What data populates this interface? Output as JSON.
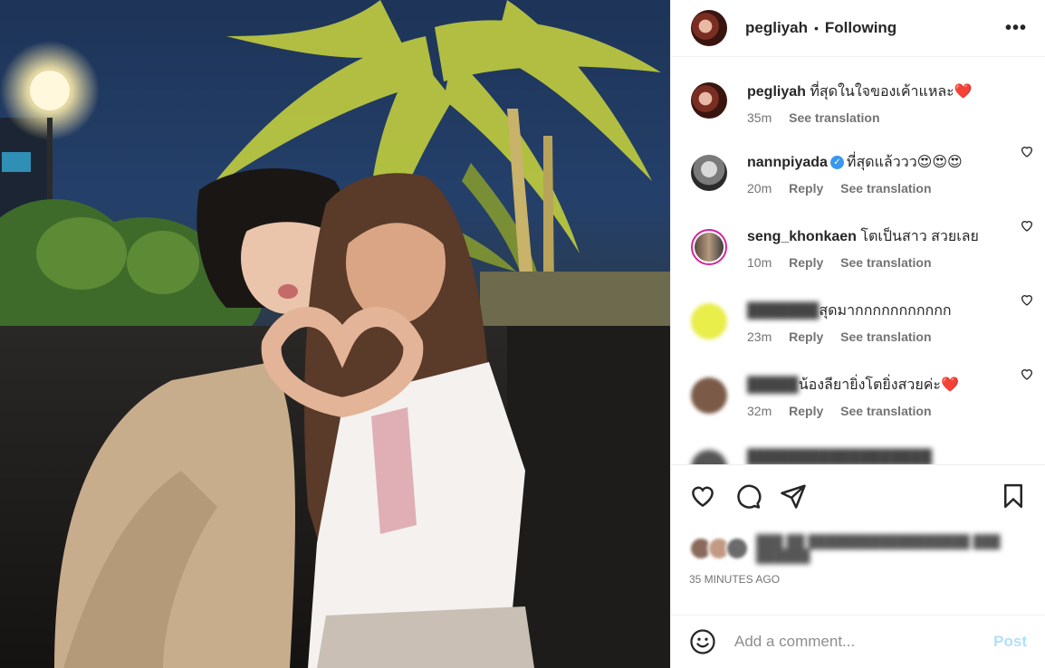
{
  "header": {
    "username": "pegliyah",
    "separator": "•",
    "follow_status": "Following",
    "more_icon": "more-horizontal-icon"
  },
  "caption": {
    "username": "pegliyah",
    "text": "ที่สุดในใจของเค้าแหละ",
    "emoji": "❤️",
    "time": "35m",
    "see_translation": "See translation"
  },
  "comments": [
    {
      "username": "nannpiyada",
      "verified": true,
      "text": "ที่สุดแล้ววว😍😍😍",
      "time": "20m",
      "reply": "Reply",
      "see_translation": "See translation",
      "username_blurred": false
    },
    {
      "username": "seng_khonkaen",
      "verified": false,
      "text": "โตเป็นสาว สวยเลย",
      "time": "10m",
      "reply": "Reply",
      "see_translation": "See translation",
      "username_blurred": false
    },
    {
      "username": "",
      "verified": false,
      "text": "สุดมากกกกกกกกกกก",
      "time": "23m",
      "reply": "Reply",
      "see_translation": "See translation",
      "username_blurred": true
    },
    {
      "username": "",
      "verified": false,
      "text": "น้องลียายิ่งโตยิ่งสวยค่ะ❤️",
      "time": "32m",
      "reply": "Reply",
      "see_translation": "See translation",
      "username_blurred": true
    }
  ],
  "actions": {
    "like_icon": "heart-outline-icon",
    "comment_icon": "comment-icon",
    "share_icon": "paper-plane-icon",
    "save_icon": "bookmark-icon"
  },
  "timestamp": "35 MINUTES AGO",
  "add_comment": {
    "emoji_icon": "smiley-icon",
    "placeholder": "Add a comment...",
    "post_label": "Post"
  },
  "colors": {
    "post_button_disabled": "#b2dffc",
    "verified_badge": "#3897f0",
    "meta_text": "#737373"
  }
}
